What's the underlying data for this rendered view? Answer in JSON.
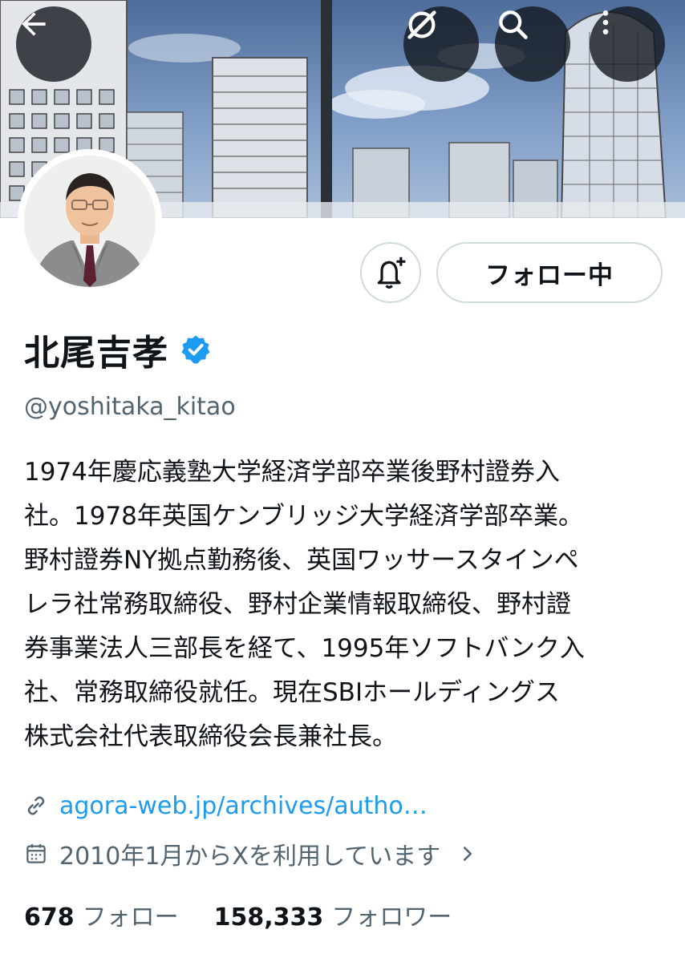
{
  "header": {
    "back_icon": "arrow-left-icon",
    "grok_icon": "grok-slash-circle-icon",
    "search_icon": "search-icon",
    "more_icon": "more-vertical-icon"
  },
  "profile": {
    "display_name": "北尾吉孝",
    "verified": true,
    "handle": "@yoshitaka_kitao",
    "bio_lines": [
      "1974年慶応義塾大学経済学部卒業後野村證券入",
      "社。1978年英国ケンブリッジ大学経済学部卒業。",
      "野村證券NY拠点勤務後、英国ワッサースタインペ",
      "レラ社常務取締役、野村企業情報取締役、野村證",
      "券事業法人三部長を経て、1995年ソフトバンク入",
      "社、常務取締役就任。現在SBIホールディングス",
      "株式会社代表取締役会長兼社長。"
    ],
    "website": "agora-web.jp/archives/autho…",
    "joined": "2010年1月からXを利用しています"
  },
  "actions": {
    "notify_icon": "bell-plus-icon",
    "follow_label": "フォロー中"
  },
  "stats": {
    "following_count": "678",
    "following_label": "フォロー",
    "followers_count": "158,333",
    "followers_label": "フォロワー"
  },
  "colors": {
    "link": "#1d9bf0",
    "verified": "#1d9bf0",
    "secondary_text": "#536471",
    "border": "#cfd9de"
  }
}
